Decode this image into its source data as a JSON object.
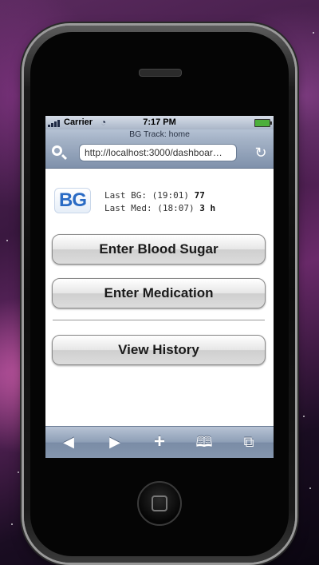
{
  "status_bar": {
    "carrier": "Carrier",
    "time": "7:17 PM"
  },
  "browser": {
    "title": "BG Track: home",
    "url": "http://localhost:3000/dashboar…"
  },
  "page": {
    "logo_text": "BG",
    "last_bg_label": "Last BG: (19:01) ",
    "last_bg_value": "77",
    "last_med_label": "Last Med: (18:07) ",
    "last_med_value": "3 h",
    "buttons": {
      "enter_blood_sugar": "Enter Blood Sugar",
      "enter_medication": "Enter Medication",
      "view_history": "View History"
    }
  },
  "icons": {
    "wifi": "wifi-icon",
    "battery": "battery-icon",
    "search": "search-icon",
    "reload": "reload-icon",
    "back": "back-icon",
    "forward": "forward-icon",
    "add": "add-icon",
    "bookmarks": "bookmarks-icon",
    "pages": "pages-icon"
  },
  "colors": {
    "logo_blue": "#2a6bc4",
    "toolbar_blue": "#8d9eb6"
  }
}
